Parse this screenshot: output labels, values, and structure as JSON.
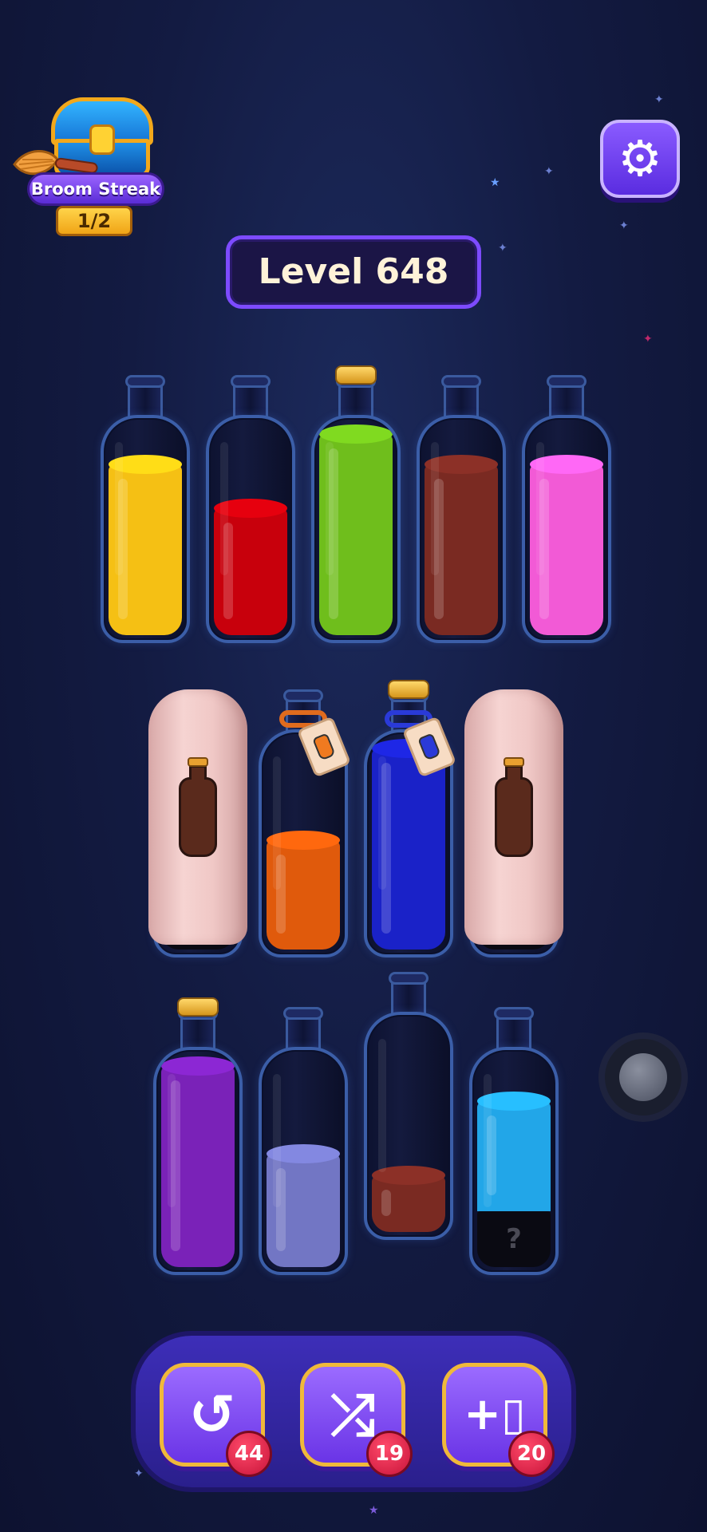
{
  "streak": {
    "label": "Broom Streak",
    "progress": "1/2"
  },
  "level": {
    "label": "Level 648"
  },
  "settings": {
    "icon": "gear-icon"
  },
  "mystery_mark": "?",
  "bottles": [
    {
      "id": "r1b1",
      "liquid_color": "#f5c014",
      "fill": 0.78,
      "cork": false
    },
    {
      "id": "r1b2",
      "liquid_color": "#c8000c",
      "fill": 0.58,
      "cork": false
    },
    {
      "id": "r1b3",
      "liquid_color": "#6fbe1c",
      "fill": 1.0,
      "cork": true
    },
    {
      "id": "r1b4",
      "liquid_color": "#7a2a22",
      "fill": 0.78,
      "cork": false
    },
    {
      "id": "r1b5",
      "liquid_color": "#f25ad6",
      "fill": 0.78,
      "cork": false
    },
    {
      "id": "r2b1",
      "covered": true
    },
    {
      "id": "r2b2",
      "liquid_color": "#e05a0c",
      "fill": 0.5,
      "rope_color": "#e06b1e",
      "tag_color": "#f07a20"
    },
    {
      "id": "r2b3",
      "liquid_color": "#1a22c8",
      "fill": 1.0,
      "cork": true,
      "rope_color": "#2a3ad8",
      "tag_color": "#2a3ad8"
    },
    {
      "id": "r2b4",
      "covered": true
    },
    {
      "id": "r3b1",
      "liquid_color": "#7a22b8",
      "fill": 1.0,
      "cork": true
    },
    {
      "id": "r3b2",
      "liquid_color": "#7276c4",
      "fill": 0.52,
      "cork": false
    },
    {
      "id": "r3b3",
      "liquid_color": "#7a2a22",
      "fill": 0.26,
      "cork": false
    },
    {
      "id": "r3b4",
      "liquid_color": "#22a6e8",
      "fill": 0.76,
      "cork": false,
      "mystery_bottom": true
    }
  ],
  "tools": {
    "undo": {
      "icon": "undo-icon",
      "count": "44"
    },
    "shuffle": {
      "icon": "shuffle-icon",
      "count": "19"
    },
    "add_bottle": {
      "icon": "add-bottle-icon",
      "count": "20"
    }
  }
}
